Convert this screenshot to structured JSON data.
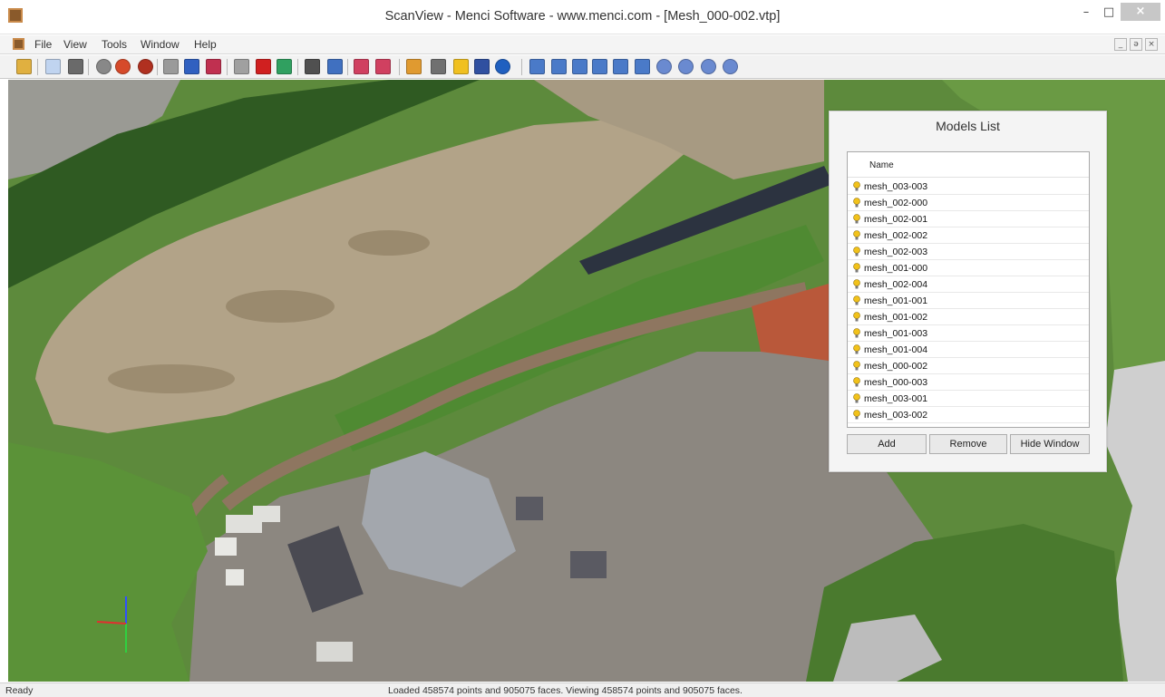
{
  "window": {
    "title": "ScanView - Menci Software - www.menci.com - [Mesh_000-002.vtp]",
    "minimize_glyph": "–",
    "maximize_glyph": "□",
    "close_glyph": "×"
  },
  "menu": {
    "items": [
      "File",
      "View",
      "Tools",
      "Window",
      "Help"
    ],
    "mdi_buttons": [
      "_",
      "ə",
      "×"
    ]
  },
  "toolbar": {
    "icons": [
      {
        "name": "open-folder-icon",
        "color": "#e0b040"
      },
      {
        "name": "list-view-icon",
        "color": "#c0d4f0"
      },
      {
        "name": "window-layout-icon",
        "color": "#6a6a6a"
      },
      {
        "name": "circle-outline-icon",
        "color": "#888888"
      },
      {
        "name": "color-sphere-icon",
        "color": "#d64a2a"
      },
      {
        "name": "red-sphere-icon",
        "color": "#b03020"
      },
      {
        "name": "box-outline-icon",
        "color": "#9a9a9a"
      },
      {
        "name": "color-box-icon",
        "color": "#3060c0"
      },
      {
        "name": "red-box-icon",
        "color": "#c03050"
      },
      {
        "name": "frame-icon",
        "color": "#a0a0a0"
      },
      {
        "name": "cube-color-icon",
        "color": "#d02020"
      },
      {
        "name": "mesh-cube-icon",
        "color": "#30a060"
      },
      {
        "name": "eye-icon",
        "color": "#505050"
      },
      {
        "name": "texture-icon",
        "color": "#4070c0"
      },
      {
        "name": "measure-line-icon",
        "color": "#d04060"
      },
      {
        "name": "measure-line-2-icon",
        "color": "#d04060"
      },
      {
        "name": "ruler-icon",
        "color": "#e09a30"
      },
      {
        "name": "printer-icon",
        "color": "#707070"
      },
      {
        "name": "lightbulb-icon",
        "color": "#f0c020"
      },
      {
        "name": "magnet-icon",
        "color": "#3050a0"
      },
      {
        "name": "info-icon",
        "color": "#2060c0"
      },
      {
        "name": "view-front-icon",
        "color": "#4a7ac8"
      },
      {
        "name": "view-back-icon",
        "color": "#4a7ac8"
      },
      {
        "name": "view-left-icon",
        "color": "#4a7ac8"
      },
      {
        "name": "view-right-icon",
        "color": "#4a7ac8"
      },
      {
        "name": "view-top-icon",
        "color": "#4a7ac8"
      },
      {
        "name": "view-bottom-icon",
        "color": "#4a7ac8"
      },
      {
        "name": "view-iso-1-icon",
        "color": "#6a8ad0"
      },
      {
        "name": "view-iso-2-icon",
        "color": "#6a8ad0"
      },
      {
        "name": "view-iso-3-icon",
        "color": "#6a8ad0"
      },
      {
        "name": "view-iso-4-icon",
        "color": "#6a8ad0"
      }
    ]
  },
  "models_list": {
    "title": "Models List",
    "column_header": "Name",
    "items": [
      "mesh_003-003",
      "mesh_002-000",
      "mesh_002-001",
      "mesh_002-002",
      "mesh_002-003",
      "mesh_001-000",
      "mesh_002-004",
      "mesh_001-001",
      "mesh_001-002",
      "mesh_001-003",
      "mesh_001-004",
      "mesh_000-002",
      "mesh_000-003",
      "mesh_003-001",
      "mesh_003-002"
    ],
    "buttons": {
      "add": "Add",
      "remove": "Remove",
      "hide": "Hide Window"
    }
  },
  "status": {
    "left": "Ready",
    "center": "Loaded 458574 points and 905075 faces. Viewing 458574 points and 905075 faces."
  },
  "colors": {
    "bulb": "#f2c21a",
    "grass": "#5a8a3a",
    "gravel": "#a89a80",
    "quarry": "#8e8a84"
  }
}
